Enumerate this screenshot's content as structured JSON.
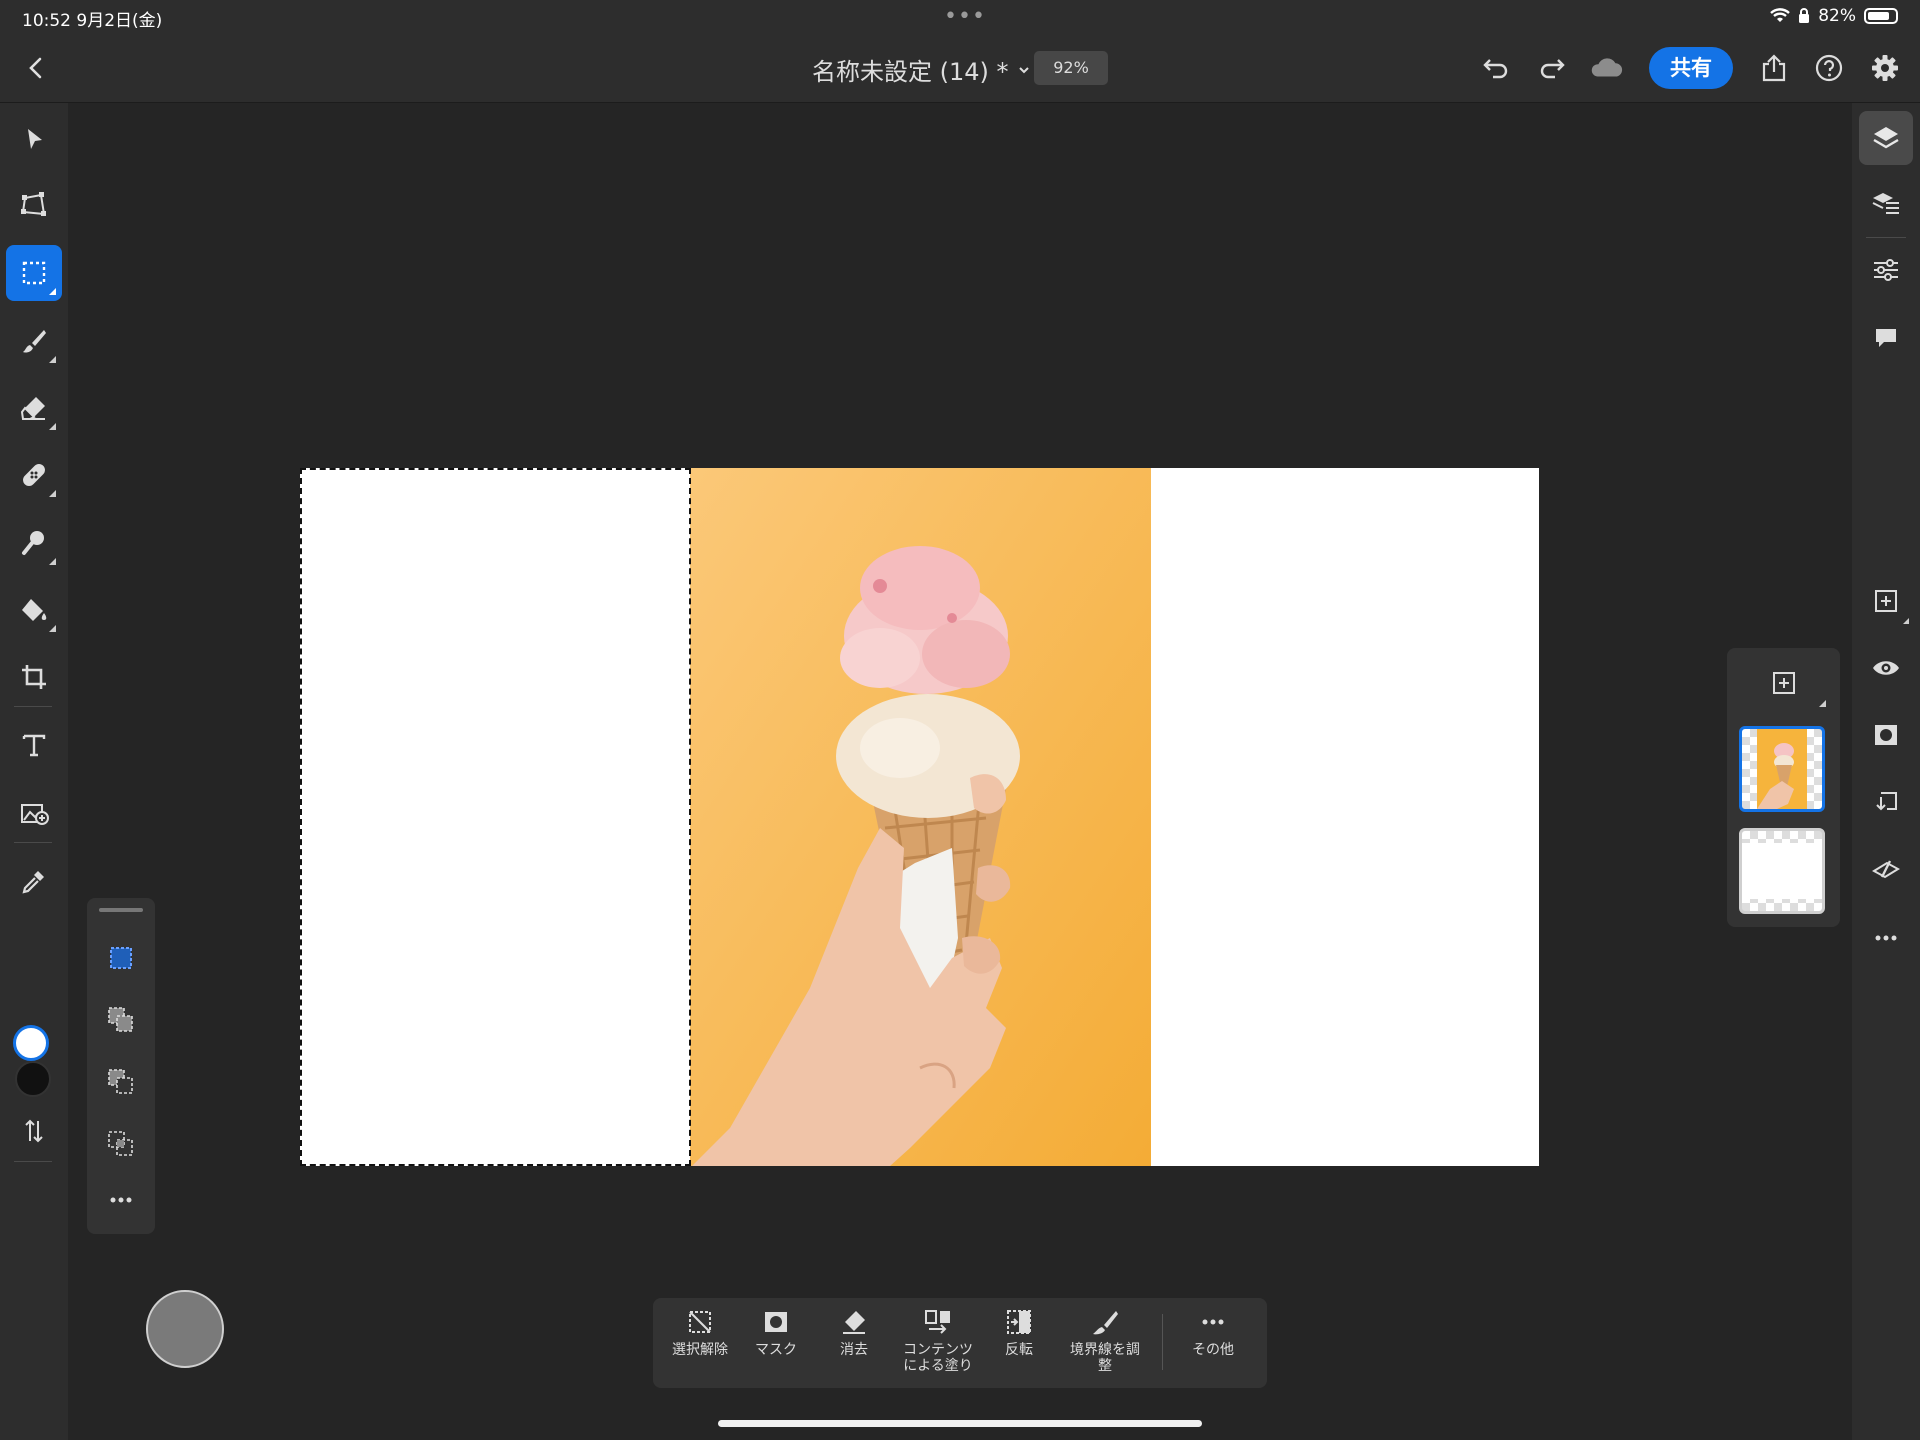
{
  "status_bar": {
    "time_date": "10:52   9月2日(金)",
    "dots": "•••",
    "battery_text": "82%",
    "battery_level": 0.82
  },
  "top_bar": {
    "title": "名称未設定 (14) *",
    "zoom": "92%",
    "share_label": "共有"
  },
  "left_toolbar": {
    "tools": [
      "select-tool",
      "transform-tool",
      "marquee-tool",
      "brush-tool",
      "eraser-tool",
      "healing-tool",
      "clone-tool",
      "fill-tool",
      "crop-tool",
      "type-tool",
      "place-image-tool",
      "eyedropper-tool"
    ],
    "active_tool": "marquee-tool",
    "foreground_color": "#ffffff",
    "background_color": "#111111"
  },
  "selection_modes": [
    "new-selection",
    "add-to-selection",
    "subtract-from-selection",
    "intersect-selection"
  ],
  "layers": [
    {
      "name": "ice-cream-photo-layer",
      "selected": true
    },
    {
      "name": "blank-layer",
      "selected": false
    }
  ],
  "action_bar": {
    "deselect": "選択解除",
    "mask": "マスク",
    "erase": "消去",
    "content_fill_line1": "コンテンツ",
    "content_fill_line2": "による塗り",
    "invert": "反転",
    "refine_edge_line1": "境界線を調",
    "refine_edge_line2": "整",
    "more": "その他"
  },
  "colors": {
    "accent": "#1473e6",
    "panel": "#2d2d2d",
    "workspace": "#252525",
    "photo_background": "#f6b43c"
  }
}
